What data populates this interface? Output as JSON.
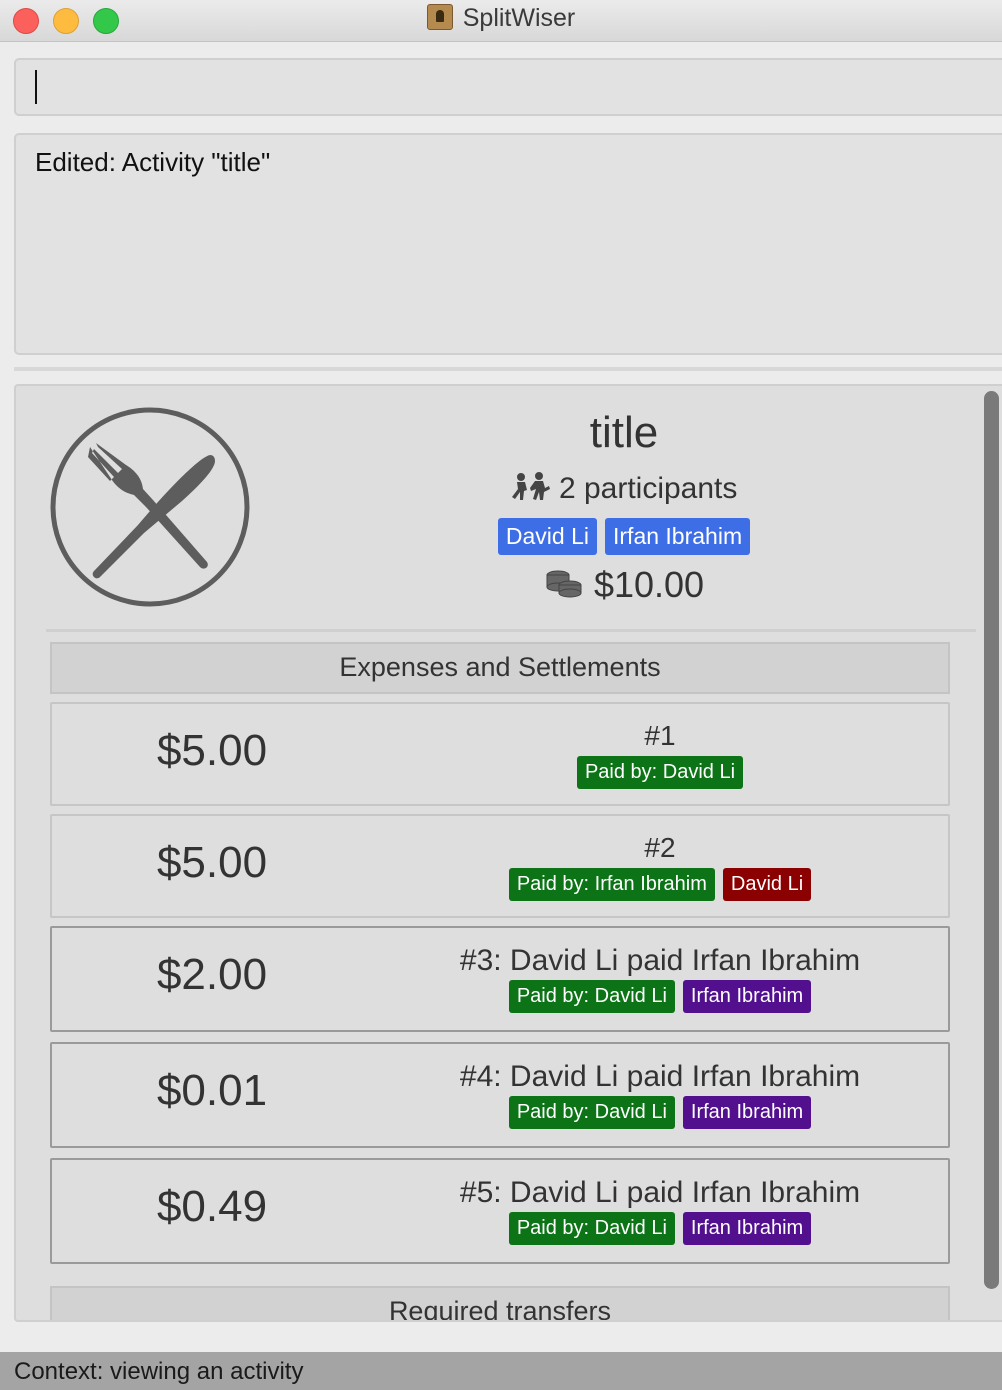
{
  "window": {
    "title": "SplitWiser"
  },
  "command": {
    "value": ""
  },
  "result": {
    "text": "Edited: Activity \"title\""
  },
  "activity": {
    "title": "title",
    "participants_text": "2 participants",
    "participants": [
      "David Li",
      "Irfan Ibrahim"
    ],
    "total": "$10.00",
    "icon": "utensils-plate-icon"
  },
  "sections": {
    "expenses_header": "Expenses and Settlements",
    "transfers_header": "Required transfers"
  },
  "expenses": [
    {
      "amount": "$5.00",
      "description": "#1",
      "paid_by": "Paid by: David Li",
      "involved": null
    },
    {
      "amount": "$5.00",
      "description": "#2",
      "paid_by": "Paid by: Irfan Ibrahim",
      "involved": "David Li"
    },
    {
      "amount": "$2.00",
      "description": "#3: David Li paid Irfan Ibrahim",
      "paid_by": "Paid by: David Li",
      "involved": "Irfan Ibrahim"
    },
    {
      "amount": "$0.01",
      "description": "#4: David Li paid Irfan Ibrahim",
      "paid_by": "Paid by: David Li",
      "involved": "Irfan Ibrahim"
    },
    {
      "amount": "$0.49",
      "description": "#5: David Li paid Irfan Ibrahim",
      "paid_by": "Paid by: David Li",
      "involved": "Irfan Ibrahim"
    }
  ],
  "status": {
    "text": "Context: viewing an activity"
  },
  "colors": {
    "participant_tag": "#3e6ee6",
    "paid_by_tag": "#0c7417",
    "involved_expense_tag": "#8b0000",
    "involved_settlement_tag": "#52108e"
  }
}
